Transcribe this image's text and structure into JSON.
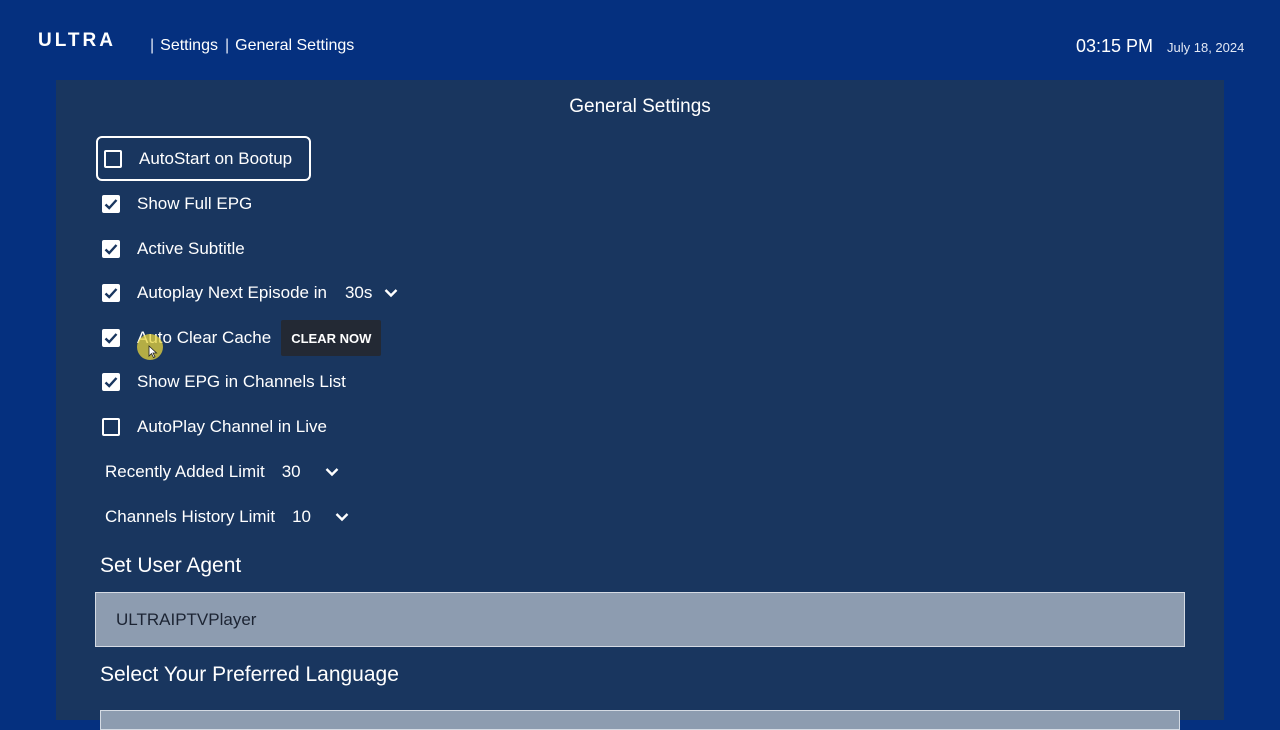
{
  "header": {
    "logo": "ULTRA",
    "sep1": "|",
    "crumb1": "Settings",
    "sep2": "|",
    "crumb2": "General Settings",
    "time": "03:15 PM",
    "date": "July 18, 2024"
  },
  "panel": {
    "title": "General Settings"
  },
  "options": {
    "autostart": {
      "label": "AutoStart on Bootup",
      "checked": false
    },
    "full_epg": {
      "label": "Show Full EPG",
      "checked": true
    },
    "subtitle": {
      "label": "Active Subtitle",
      "checked": true
    },
    "autoplay_next": {
      "label": "Autoplay Next Episode in",
      "checked": true,
      "value": "30s"
    },
    "auto_clear": {
      "label": "Auto Clear Cache",
      "checked": true,
      "button": "CLEAR NOW"
    },
    "epg_channels": {
      "label": "Show EPG in Channels List",
      "checked": true
    },
    "autoplay_live": {
      "label": "AutoPlay Channel in Live",
      "checked": false
    }
  },
  "limits": {
    "recent": {
      "label": "Recently Added Limit",
      "value": "30"
    },
    "history": {
      "label": "Channels History Limit",
      "value": "10"
    }
  },
  "user_agent": {
    "title": "Set User Agent",
    "value": "ULTRAIPTVPlayer"
  },
  "language": {
    "title": "Select Your Preferred Language"
  },
  "icons": {
    "checkbox": "check-icon",
    "dropdown": "chevron-down-icon",
    "cursor": "mouse-cursor-icon"
  },
  "colors": {
    "background": "#05307f",
    "panel": "#19365f",
    "input": "#8d9cb0",
    "button": "#232934",
    "cursor_highlight": "#e8d63c"
  }
}
